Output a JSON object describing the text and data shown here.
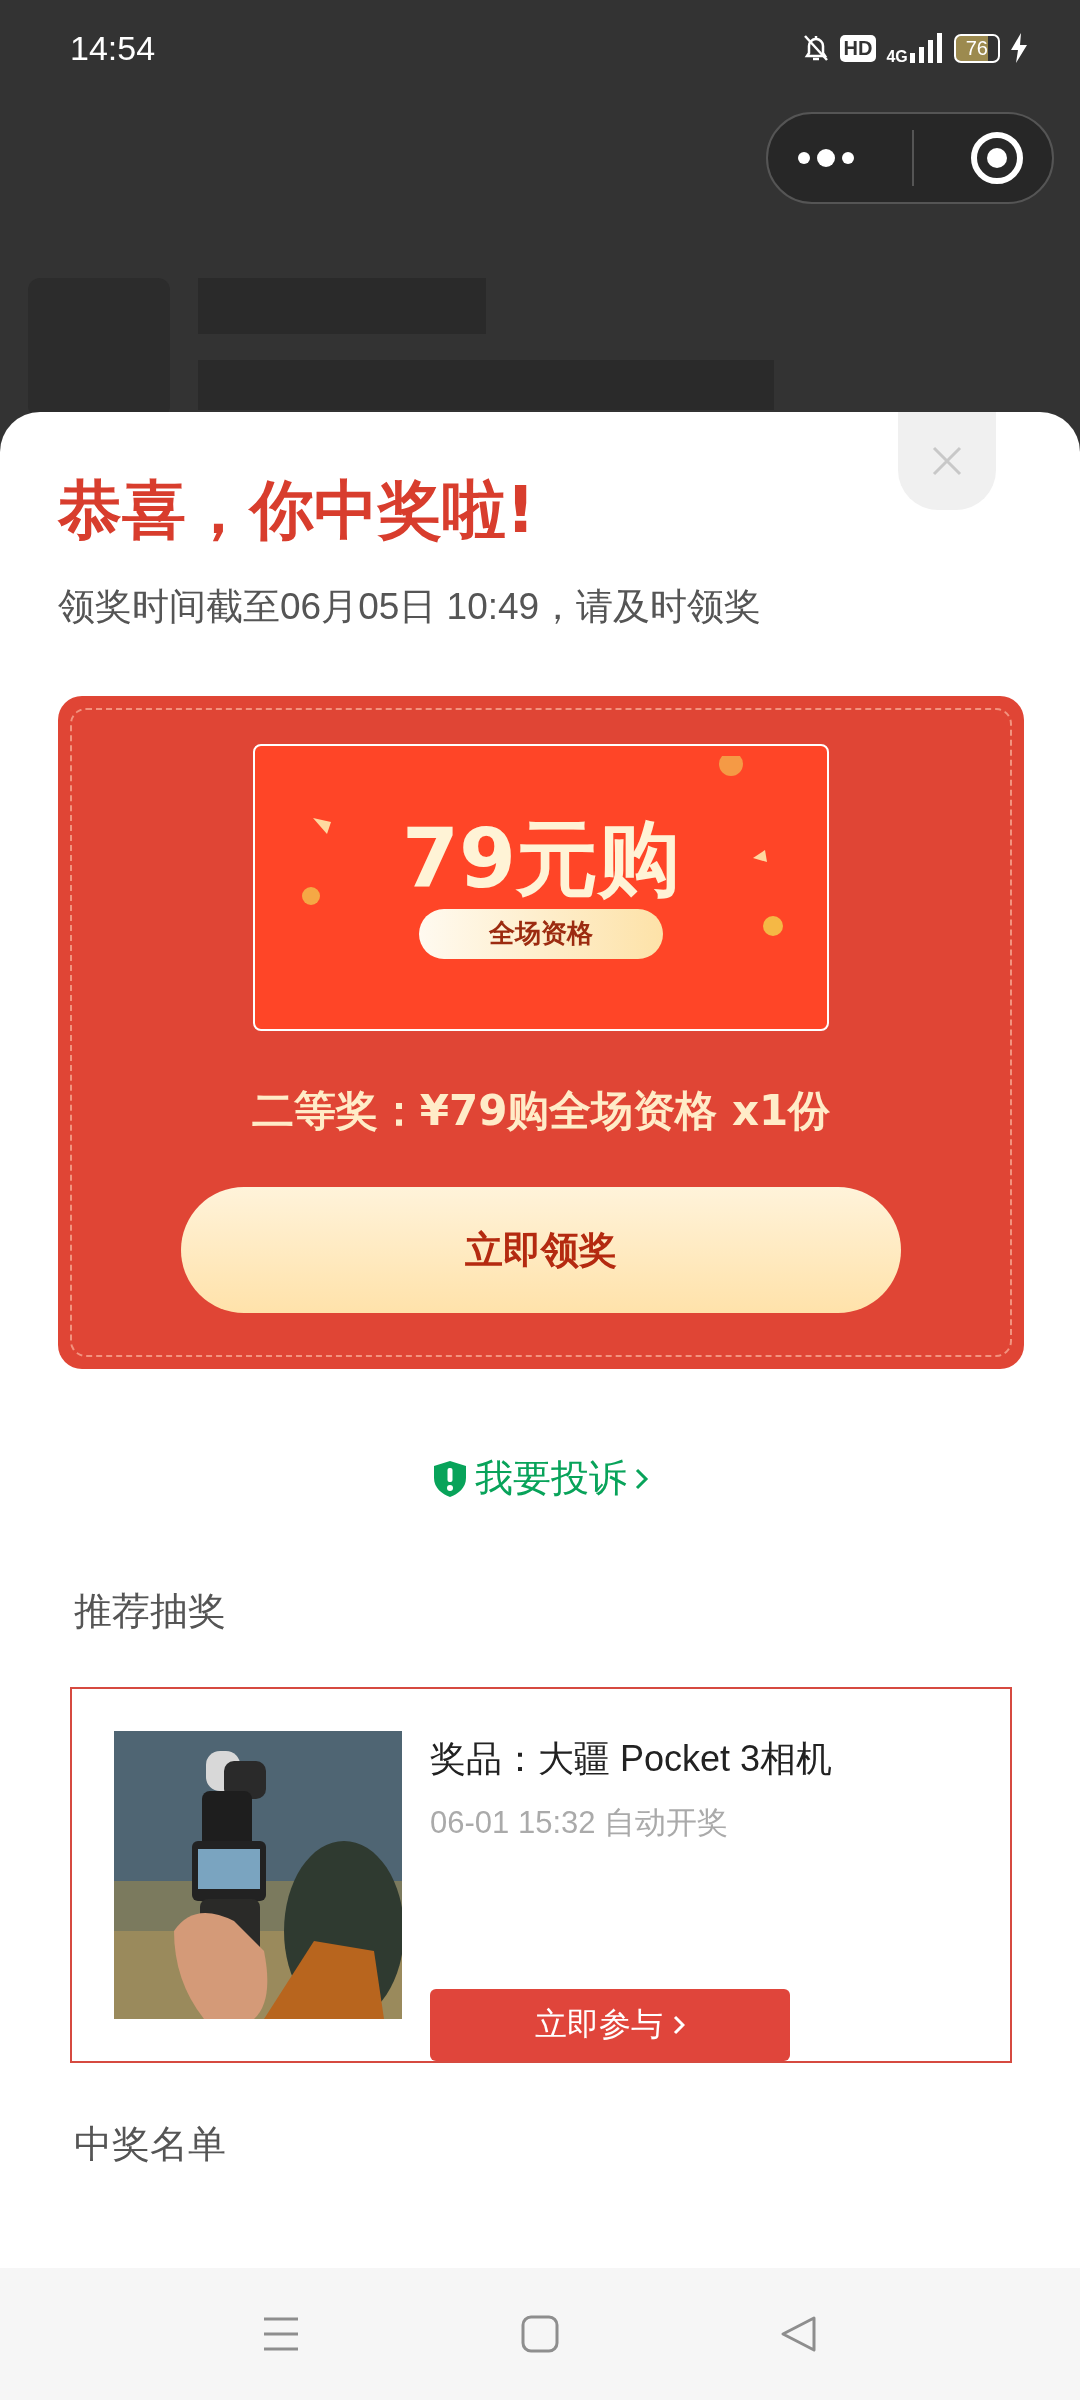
{
  "status_bar": {
    "time": "14:54",
    "hd_badge": "HD",
    "network": "4G",
    "battery": "76"
  },
  "prize_sheet": {
    "title": "恭喜，你中奖啦!",
    "deadline": "领奖时间截至06月05日 10:49，请及时领奖",
    "voucher": {
      "headline": "79元购",
      "tag": "全场资格"
    },
    "prize_line": "二等奖：¥79购全场资格 x1份",
    "claim_button": "立即领奖",
    "complaint_link": "我要投诉"
  },
  "recommended": {
    "heading": "推荐抽奖",
    "items": [
      {
        "kind": "picture",
        "prize": "奖品：大疆 Pocket 3相机",
        "draw_time": "06-01 15:32 自动开奖",
        "button": "立即参与"
      }
    ]
  },
  "winners": {
    "heading": "中奖名单"
  }
}
